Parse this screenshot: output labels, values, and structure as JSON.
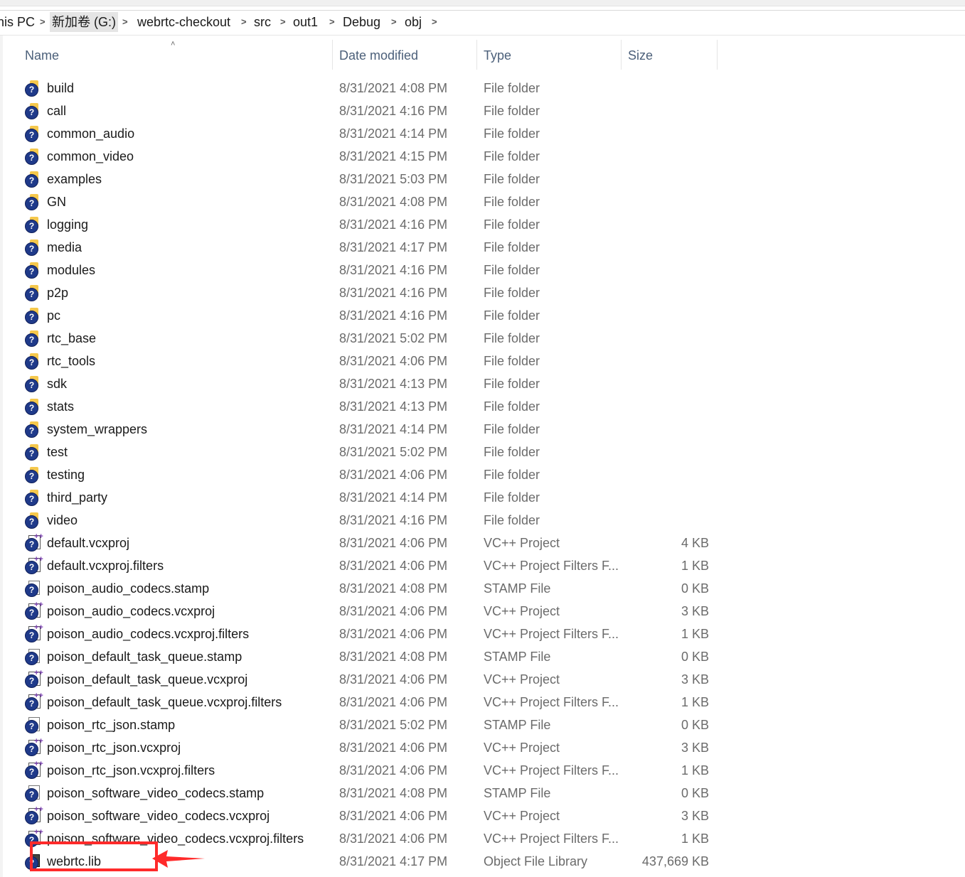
{
  "breadcrumb": [
    {
      "label": "nis PC",
      "selected": false
    },
    {
      "label": "新加卷 (G:)",
      "selected": true
    },
    {
      "label": "webrtc-checkout",
      "selected": false
    },
    {
      "label": "src",
      "selected": false
    },
    {
      "label": "out1",
      "selected": false
    },
    {
      "label": "Debug",
      "selected": false
    },
    {
      "label": "obj",
      "selected": false
    }
  ],
  "columns": {
    "name": "Name",
    "date": "Date modified",
    "type": "Type",
    "size": "Size"
  },
  "files": [
    {
      "name": "build",
      "date": "8/31/2021 4:08 PM",
      "type": "File folder",
      "size": "",
      "icon": "folder-icon"
    },
    {
      "name": "call",
      "date": "8/31/2021 4:16 PM",
      "type": "File folder",
      "size": "",
      "icon": "folder-icon"
    },
    {
      "name": "common_audio",
      "date": "8/31/2021 4:14 PM",
      "type": "File folder",
      "size": "",
      "icon": "folder-icon"
    },
    {
      "name": "common_video",
      "date": "8/31/2021 4:15 PM",
      "type": "File folder",
      "size": "",
      "icon": "folder-icon"
    },
    {
      "name": "examples",
      "date": "8/31/2021 5:03 PM",
      "type": "File folder",
      "size": "",
      "icon": "folder-icon"
    },
    {
      "name": "GN",
      "date": "8/31/2021 4:08 PM",
      "type": "File folder",
      "size": "",
      "icon": "folder-icon"
    },
    {
      "name": "logging",
      "date": "8/31/2021 4:16 PM",
      "type": "File folder",
      "size": "",
      "icon": "folder-icon"
    },
    {
      "name": "media",
      "date": "8/31/2021 4:17 PM",
      "type": "File folder",
      "size": "",
      "icon": "folder-icon"
    },
    {
      "name": "modules",
      "date": "8/31/2021 4:16 PM",
      "type": "File folder",
      "size": "",
      "icon": "folder-icon"
    },
    {
      "name": "p2p",
      "date": "8/31/2021 4:16 PM",
      "type": "File folder",
      "size": "",
      "icon": "folder-icon"
    },
    {
      "name": "pc",
      "date": "8/31/2021 4:16 PM",
      "type": "File folder",
      "size": "",
      "icon": "folder-icon"
    },
    {
      "name": "rtc_base",
      "date": "8/31/2021 5:02 PM",
      "type": "File folder",
      "size": "",
      "icon": "folder-icon"
    },
    {
      "name": "rtc_tools",
      "date": "8/31/2021 4:06 PM",
      "type": "File folder",
      "size": "",
      "icon": "folder-icon"
    },
    {
      "name": "sdk",
      "date": "8/31/2021 4:13 PM",
      "type": "File folder",
      "size": "",
      "icon": "folder-icon"
    },
    {
      "name": "stats",
      "date": "8/31/2021 4:13 PM",
      "type": "File folder",
      "size": "",
      "icon": "folder-icon"
    },
    {
      "name": "system_wrappers",
      "date": "8/31/2021 4:14 PM",
      "type": "File folder",
      "size": "",
      "icon": "folder-icon"
    },
    {
      "name": "test",
      "date": "8/31/2021 5:02 PM",
      "type": "File folder",
      "size": "",
      "icon": "folder-icon"
    },
    {
      "name": "testing",
      "date": "8/31/2021 4:06 PM",
      "type": "File folder",
      "size": "",
      "icon": "folder-icon"
    },
    {
      "name": "third_party",
      "date": "8/31/2021 4:14 PM",
      "type": "File folder",
      "size": "",
      "icon": "folder-icon"
    },
    {
      "name": "video",
      "date": "8/31/2021 4:16 PM",
      "type": "File folder",
      "size": "",
      "icon": "folder-icon"
    },
    {
      "name": "default.vcxproj",
      "date": "8/31/2021 4:06 PM",
      "type": "VC++ Project",
      "size": "4 KB",
      "icon": "vcxproj-icon"
    },
    {
      "name": "default.vcxproj.filters",
      "date": "8/31/2021 4:06 PM",
      "type": "VC++ Project Filters F...",
      "size": "1 KB",
      "icon": "filters-icon"
    },
    {
      "name": "poison_audio_codecs.stamp",
      "date": "8/31/2021 4:08 PM",
      "type": "STAMP File",
      "size": "0 KB",
      "icon": "file-icon"
    },
    {
      "name": "poison_audio_codecs.vcxproj",
      "date": "8/31/2021 4:06 PM",
      "type": "VC++ Project",
      "size": "3 KB",
      "icon": "vcxproj-icon"
    },
    {
      "name": "poison_audio_codecs.vcxproj.filters",
      "date": "8/31/2021 4:06 PM",
      "type": "VC++ Project Filters F...",
      "size": "1 KB",
      "icon": "filters-icon"
    },
    {
      "name": "poison_default_task_queue.stamp",
      "date": "8/31/2021 4:08 PM",
      "type": "STAMP File",
      "size": "0 KB",
      "icon": "file-icon"
    },
    {
      "name": "poison_default_task_queue.vcxproj",
      "date": "8/31/2021 4:06 PM",
      "type": "VC++ Project",
      "size": "3 KB",
      "icon": "vcxproj-icon"
    },
    {
      "name": "poison_default_task_queue.vcxproj.filters",
      "date": "8/31/2021 4:06 PM",
      "type": "VC++ Project Filters F...",
      "size": "1 KB",
      "icon": "filters-icon"
    },
    {
      "name": "poison_rtc_json.stamp",
      "date": "8/31/2021 5:02 PM",
      "type": "STAMP File",
      "size": "0 KB",
      "icon": "file-icon"
    },
    {
      "name": "poison_rtc_json.vcxproj",
      "date": "8/31/2021 4:06 PM",
      "type": "VC++ Project",
      "size": "3 KB",
      "icon": "vcxproj-icon"
    },
    {
      "name": "poison_rtc_json.vcxproj.filters",
      "date": "8/31/2021 4:06 PM",
      "type": "VC++ Project Filters F...",
      "size": "1 KB",
      "icon": "filters-icon"
    },
    {
      "name": "poison_software_video_codecs.stamp",
      "date": "8/31/2021 4:08 PM",
      "type": "STAMP File",
      "size": "0 KB",
      "icon": "file-icon"
    },
    {
      "name": "poison_software_video_codecs.vcxproj",
      "date": "8/31/2021 4:06 PM",
      "type": "VC++ Project",
      "size": "3 KB",
      "icon": "vcxproj-icon"
    },
    {
      "name": "poison_software_video_codecs.vcxproj.filters",
      "date": "8/31/2021 4:06 PM",
      "type": "VC++ Project Filters F...",
      "size": "1 KB",
      "icon": "filters-icon"
    },
    {
      "name": "webrtc.lib",
      "date": "8/31/2021 4:17 PM",
      "type": "Object File Library",
      "size": "437,669 KB",
      "icon": "lib-icon"
    }
  ],
  "annotation_color": "#ff2a2a"
}
